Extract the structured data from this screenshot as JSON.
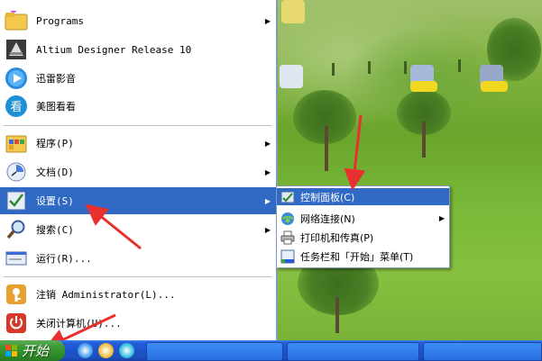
{
  "start_menu": {
    "pinned": [
      {
        "label": "Programs",
        "icon": "programs-folder-icon",
        "has_submenu": true
      },
      {
        "label": "Altium Designer Release 10",
        "icon": "altium-icon",
        "has_submenu": false
      },
      {
        "label": "迅雷影音",
        "icon": "xunlei-player-icon",
        "has_submenu": false
      },
      {
        "label": "美图看看",
        "icon": "meitu-viewer-icon",
        "has_submenu": false
      }
    ],
    "items": [
      {
        "label": "程序(P)",
        "icon": "programs-icon",
        "has_submenu": true
      },
      {
        "label": "文档(D)",
        "icon": "documents-icon",
        "has_submenu": true
      },
      {
        "label": "设置(S)",
        "icon": "settings-icon",
        "has_submenu": true
      },
      {
        "label": "搜索(C)",
        "icon": "search-icon",
        "has_submenu": true
      },
      {
        "label": "运行(R)...",
        "icon": "run-icon",
        "has_submenu": false
      }
    ],
    "bottom": [
      {
        "label": "注销 Administrator(L)...",
        "icon": "logoff-icon"
      },
      {
        "label": "关闭计算机(U)...",
        "icon": "shutdown-icon"
      }
    ]
  },
  "submenu": {
    "items": [
      {
        "label": "控制面板(C)",
        "icon": "control-panel-icon",
        "has_submenu": false
      },
      {
        "label": "网络连接(N)",
        "icon": "network-icon",
        "has_submenu": true
      },
      {
        "label": "打印机和传真(P)",
        "icon": "printer-icon",
        "has_submenu": false
      },
      {
        "label": "任务栏和「开始」菜单(T)",
        "icon": "taskbar-icon",
        "has_submenu": false
      }
    ]
  },
  "taskbar": {
    "start_label": "开始"
  },
  "colors": {
    "highlight": "#316ac5",
    "taskbar_blue": "#245edb",
    "start_green": "#3c9a34",
    "annotation_red": "#e8312e"
  }
}
